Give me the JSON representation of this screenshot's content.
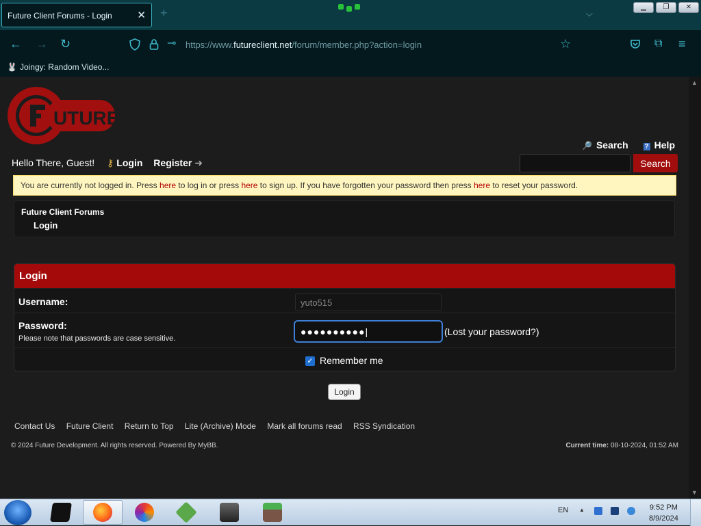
{
  "browser": {
    "tab_title": "Future Client Forums - Login",
    "url_prefix": "https://www.",
    "url_domain": "futureclient.net",
    "url_path": "/forum/member.php?action=login",
    "bookmark": "Joingy: Random Video..."
  },
  "header": {
    "search_link": "Search",
    "help_link": "Help",
    "greeting": "Hello There, Guest!",
    "login_link": "Login",
    "register_link": "Register",
    "search_button": "Search"
  },
  "notice": {
    "p1": "You are currently not logged in. Press ",
    "here1": "here",
    "p2": " to log in or press ",
    "here2": "here",
    "p3": " to sign up. If you have forgotten your password then press ",
    "here3": "here",
    "p4": " to reset your password."
  },
  "breadcrumb": {
    "root": "Future Client Forums",
    "current": "Login"
  },
  "login": {
    "title": "Login",
    "username_label": "Username:",
    "username_value": "yuto515",
    "password_label": "Password:",
    "password_note": "Please note that passwords are case sensitive.",
    "password_value": "●●●●●●●●●●|",
    "lost_password": "(Lost your password?)",
    "remember_label": "Remember me",
    "submit": "Login"
  },
  "footer": {
    "links": [
      "Contact Us",
      "Future Client",
      "Return to Top",
      "Lite (Archive) Mode",
      "Mark all forums read",
      "RSS Syndication"
    ],
    "copyright": "© 2024 Future Development. All rights reserved. Powered By MyBB.",
    "current_time_label": "Current time:",
    "current_time_value": " 08-10-2024, 01:52 AM"
  },
  "taskbar": {
    "language": "EN",
    "time": "9:52 PM",
    "date": "8/9/2024"
  },
  "colors": {
    "accent_red": "#a50a0a",
    "notice_bg": "#fff6bf",
    "browser_teal": "#0b3a42"
  }
}
